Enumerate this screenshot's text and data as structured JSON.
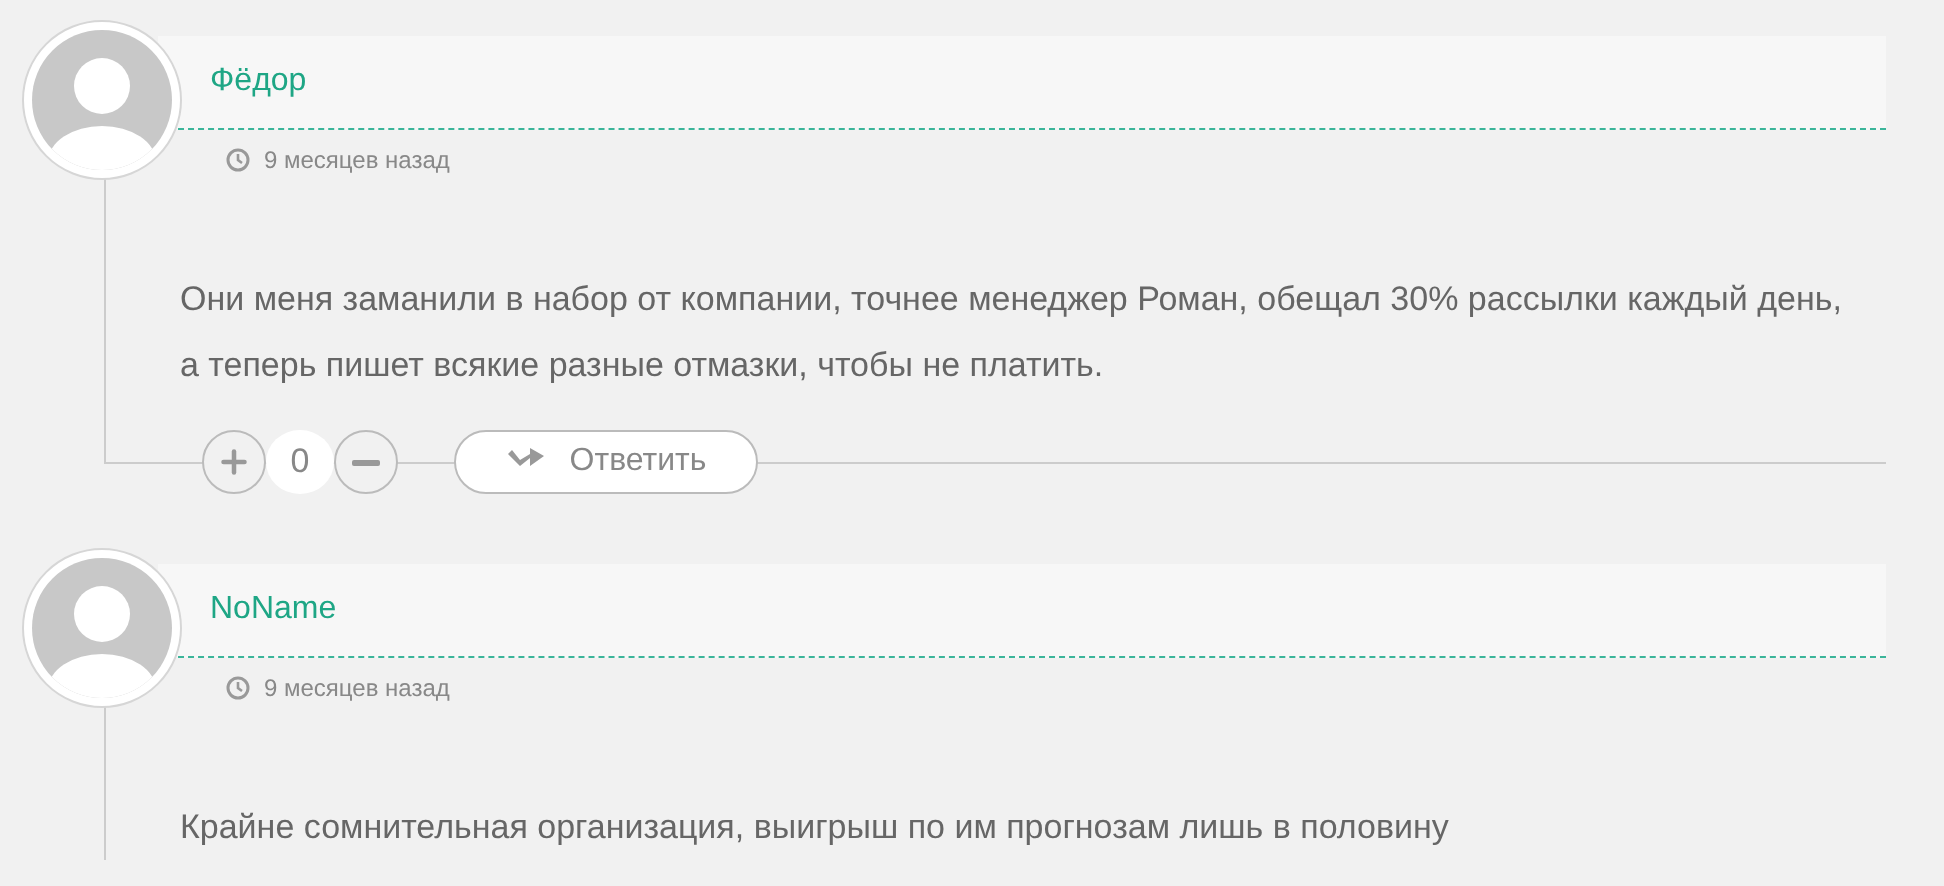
{
  "comments": [
    {
      "author": "Фёдор",
      "time": "9 месяцев назад",
      "text": "Они меня заманили в набор от компании, точнее менеджер Роман, обещал 30% рассылки каждый день, а теперь пишет всякие разные отмазки, чтобы не платить.",
      "score": "0",
      "reply": "Ответить"
    },
    {
      "author": "NoName",
      "time": "9 месяцев назад",
      "text": "Крайне сомнительная организация, выигрыш по им прогнозам лишь в половину"
    }
  ]
}
